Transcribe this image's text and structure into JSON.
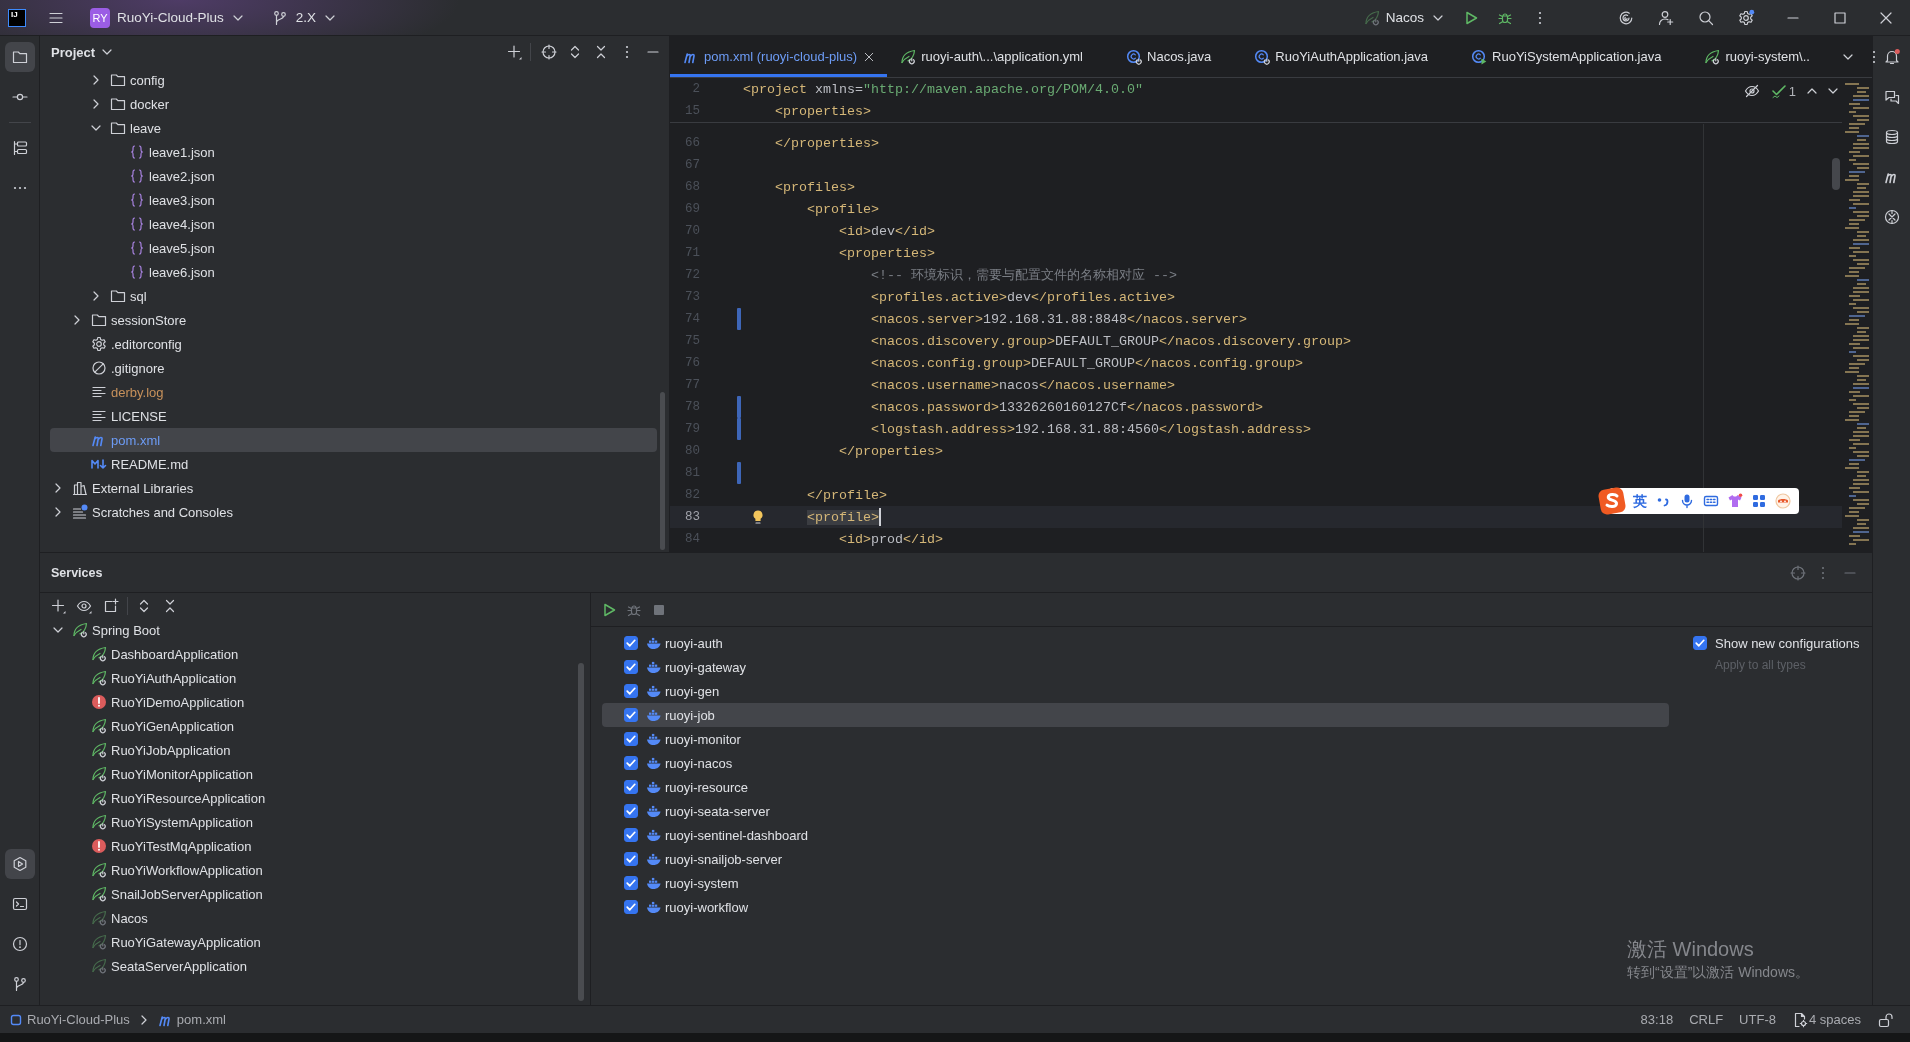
{
  "title_bar": {
    "logo_text": "IJ",
    "project_badge": "RY",
    "project_name": "RuoYi-Cloud-Plus",
    "branch": "2.X",
    "run_configuration": "Nacos",
    "settings_badge": true
  },
  "tool_strip_left": {
    "top": [
      {
        "kind": "project",
        "selected": true
      },
      {
        "kind": "commit",
        "selected": false
      },
      {
        "kind": "structure",
        "selected": false
      },
      {
        "kind": "more",
        "selected": false
      }
    ],
    "bottom": [
      {
        "kind": "services",
        "selected": true
      },
      {
        "kind": "terminal",
        "selected": false
      },
      {
        "kind": "problems",
        "selected": false
      },
      {
        "kind": "git",
        "selected": false
      }
    ]
  },
  "tool_strip_right": [
    {
      "kind": "notifications",
      "badge": true
    },
    {
      "kind": "ai_chat",
      "badge": false
    },
    {
      "kind": "database",
      "badge": false
    },
    {
      "kind": "maven",
      "badge": false
    },
    {
      "kind": "plugin",
      "badge": false
    }
  ],
  "project_panel": {
    "title": "Project",
    "tree": [
      {
        "children": [
          {
            "children": [
              {
                "label": "config",
                "kind": "folder",
                "expanded": false,
                "selected": false,
                "modified": false,
                "ignored": false
              },
              {
                "label": "docker",
                "kind": "folder",
                "expanded": false,
                "selected": false,
                "modified": false,
                "ignored": false
              },
              {
                "label": "leave",
                "kind": "folder",
                "expanded": true,
                "selected": false,
                "modified": false,
                "ignored": false,
                "children": [
                  {
                    "label": "leave1.json",
                    "kind": "json",
                    "selected": false,
                    "modified": false,
                    "ignored": false
                  },
                  {
                    "label": "leave2.json",
                    "kind": "json",
                    "selected": false,
                    "modified": false,
                    "ignored": false
                  },
                  {
                    "label": "leave3.json",
                    "kind": "json",
                    "selected": false,
                    "modified": false,
                    "ignored": false
                  },
                  {
                    "label": "leave4.json",
                    "kind": "json",
                    "selected": false,
                    "modified": false,
                    "ignored": false
                  },
                  {
                    "label": "leave5.json",
                    "kind": "json",
                    "selected": false,
                    "modified": false,
                    "ignored": false
                  },
                  {
                    "label": "leave6.json",
                    "kind": "json",
                    "selected": false,
                    "modified": false,
                    "ignored": false
                  }
                ]
              },
              {
                "label": "sql",
                "kind": "folder",
                "expanded": false,
                "selected": false,
                "modified": false,
                "ignored": false
              }
            ]
          },
          {
            "label": "sessionStore",
            "kind": "folder",
            "expanded": false,
            "selected": false,
            "modified": false,
            "ignored": false
          },
          {
            "label": ".editorconfig",
            "kind": "settings",
            "selected": false,
            "modified": false,
            "ignored": false
          },
          {
            "label": ".gitignore",
            "kind": "ignore",
            "selected": false,
            "modified": false,
            "ignored": false
          },
          {
            "label": "derby.log",
            "kind": "text",
            "selected": false,
            "modified": false,
            "ignored": true
          },
          {
            "label": "LICENSE",
            "kind": "text",
            "selected": false,
            "modified": false,
            "ignored": false
          },
          {
            "label": "pom.xml",
            "kind": "maven",
            "selected": true,
            "modified": true,
            "ignored": false
          },
          {
            "label": "README.md",
            "kind": "markdown",
            "selected": false,
            "modified": false,
            "ignored": false
          }
        ]
      },
      {
        "label": "External Libraries",
        "kind": "library",
        "expanded": false,
        "selected": false,
        "modified": false,
        "ignored": false
      },
      {
        "label": "Scratches and Consoles",
        "kind": "scratches",
        "expanded": false,
        "selected": false,
        "modified": false,
        "ignored": false
      }
    ]
  },
  "editor": {
    "tabs": [
      {
        "label": "pom.xml (ruoyi-cloud-plus)",
        "kind": "maven",
        "selected": true,
        "modified": true
      },
      {
        "label": "ruoyi-auth\\...\\application.yml",
        "kind": "spring-config",
        "selected": false,
        "modified": false
      },
      {
        "label": "Nacos.java",
        "kind": "spring-class",
        "selected": false,
        "modified": false
      },
      {
        "label": "RuoYiAuthApplication.java",
        "kind": "spring-class",
        "selected": false,
        "modified": false
      },
      {
        "label": "RuoYiSystemApplication.java",
        "kind": "run-class",
        "selected": false,
        "modified": false
      },
      {
        "label": "ruoyi-system\\..",
        "kind": "spring-config",
        "selected": false,
        "modified": false
      }
    ],
    "inspection_count": "1",
    "sticky_lines": [
      {
        "number": "2",
        "segments": [
          {
            "kind": "tag",
            "text": "<project"
          },
          {
            "kind": "attr",
            "text": " xmlns="
          },
          {
            "kind": "string",
            "text": "\"http://maven.apache.org/POM/4.0.0\""
          }
        ]
      },
      {
        "number": "15",
        "segments": [
          {
            "kind": "tag",
            "text": "    <properties>"
          }
        ]
      }
    ],
    "lines": [
      {
        "number": "66",
        "changed": false,
        "current": false,
        "segments": [
          {
            "kind": "tag",
            "text": "    </properties>"
          }
        ]
      },
      {
        "number": "67",
        "changed": false,
        "current": false
      },
      {
        "number": "68",
        "changed": false,
        "current": false,
        "segments": [
          {
            "kind": "tag",
            "text": "    <profiles>"
          }
        ]
      },
      {
        "number": "69",
        "changed": false,
        "current": false,
        "segments": [
          {
            "kind": "tag",
            "text": "        <profile>"
          }
        ]
      },
      {
        "number": "70",
        "changed": false,
        "current": false,
        "segments": [
          {
            "kind": "tag",
            "text": "            <id>"
          },
          {
            "kind": "text",
            "text": "dev"
          },
          {
            "kind": "tag",
            "text": "</id>"
          }
        ]
      },
      {
        "number": "71",
        "changed": false,
        "current": false,
        "segments": [
          {
            "kind": "tag",
            "text": "            <properties>"
          }
        ]
      },
      {
        "number": "72",
        "changed": false,
        "current": false,
        "segments": [
          {
            "kind": "comment",
            "text": "                <!-- 环境标识，需要与配置文件的名称相对应 -->"
          }
        ]
      },
      {
        "number": "73",
        "changed": false,
        "current": false,
        "segments": [
          {
            "kind": "tag",
            "text": "                <profiles.active>"
          },
          {
            "kind": "text",
            "text": "dev"
          },
          {
            "kind": "tag",
            "text": "</profiles.active>"
          }
        ]
      },
      {
        "number": "74",
        "changed": true,
        "current": false,
        "segments": [
          {
            "kind": "tag",
            "text": "                <nacos.server>"
          },
          {
            "kind": "text",
            "text": "192.168.31.88:8848"
          },
          {
            "kind": "tag",
            "text": "</nacos.server>"
          }
        ]
      },
      {
        "number": "75",
        "changed": false,
        "current": false,
        "segments": [
          {
            "kind": "tag",
            "text": "                <nacos.discovery.group>"
          },
          {
            "kind": "text",
            "text": "DEFAULT_GROUP"
          },
          {
            "kind": "tag",
            "text": "</nacos.discovery.group>"
          }
        ]
      },
      {
        "number": "76",
        "changed": false,
        "current": false,
        "segments": [
          {
            "kind": "tag",
            "text": "                <nacos.config.group>"
          },
          {
            "kind": "text",
            "text": "DEFAULT_GROUP"
          },
          {
            "kind": "tag",
            "text": "</nacos.config.group>"
          }
        ]
      },
      {
        "number": "77",
        "changed": false,
        "current": false,
        "segments": [
          {
            "kind": "tag",
            "text": "                <nacos.username>"
          },
          {
            "kind": "text",
            "text": "nacos"
          },
          {
            "kind": "tag",
            "text": "</nacos.username>"
          }
        ]
      },
      {
        "number": "78",
        "changed": true,
        "current": false,
        "segments": [
          {
            "kind": "tag",
            "text": "                <nacos.password>"
          },
          {
            "kind": "text",
            "text": "13326260160127Cf"
          },
          {
            "kind": "tag",
            "text": "</nacos.password>"
          }
        ]
      },
      {
        "number": "79",
        "changed": true,
        "current": false,
        "segments": [
          {
            "kind": "tag",
            "text": "                <logstash.address>"
          },
          {
            "kind": "text",
            "text": "192.168.31.88:4560"
          },
          {
            "kind": "tag",
            "text": "</logstash.address>"
          }
        ]
      },
      {
        "number": "80",
        "changed": false,
        "current": false,
        "segments": [
          {
            "kind": "tag",
            "text": "            </properties>"
          }
        ]
      },
      {
        "number": "81",
        "changed": true,
        "current": false
      },
      {
        "number": "82",
        "changed": false,
        "current": false,
        "segments": [
          {
            "kind": "tag",
            "text": "        </profile>"
          }
        ]
      },
      {
        "number": "83",
        "changed": false,
        "current": true,
        "segments": [
          {
            "kind": "tag_match",
            "text": "        <profile>"
          }
        ]
      },
      {
        "number": "84",
        "changed": false,
        "current": false,
        "segments": [
          {
            "kind": "tag",
            "text": "            <id>"
          },
          {
            "kind": "text",
            "text": "prod"
          },
          {
            "kind": "tag",
            "text": "</id>"
          }
        ]
      }
    ]
  },
  "ime_toolbar": {
    "mode": "英"
  },
  "services": {
    "title": "Services",
    "tree": [
      {
        "label": "Spring Boot",
        "expanded": true,
        "children": [
          {
            "label": "DashboardApplication",
            "kind": "app"
          },
          {
            "label": "RuoYiAuthApplication",
            "kind": "app"
          },
          {
            "label": "RuoYiDemoApplication",
            "kind": "error"
          },
          {
            "label": "RuoYiGenApplication",
            "kind": "app"
          },
          {
            "label": "RuoYiJobApplication",
            "kind": "app"
          },
          {
            "label": "RuoYiMonitorApplication",
            "kind": "app"
          },
          {
            "label": "RuoYiResourceApplication",
            "kind": "app"
          },
          {
            "label": "RuoYiSystemApplication",
            "kind": "app"
          },
          {
            "label": "RuoYiTestMqApplication",
            "kind": "error"
          },
          {
            "label": "RuoYiWorkflowApplication",
            "kind": "app"
          },
          {
            "label": "SnailJobServerApplication",
            "kind": "app"
          },
          {
            "label": "Nacos",
            "kind": "inactive"
          },
          {
            "label": "RuoYiGatewayApplication",
            "kind": "inactive"
          },
          {
            "label": "SeataServerApplication",
            "kind": "inactive"
          }
        ]
      }
    ],
    "run_actions": [
      {
        "kind": "run",
        "disabled": false
      },
      {
        "kind": "debug",
        "disabled": true
      },
      {
        "kind": "stop",
        "disabled": true
      }
    ],
    "configurations": [
      {
        "name": "ruoyi-auth",
        "checked": true,
        "selected": false
      },
      {
        "name": "ruoyi-gateway",
        "checked": true,
        "selected": false
      },
      {
        "name": "ruoyi-gen",
        "checked": true,
        "selected": false
      },
      {
        "name": "ruoyi-job",
        "checked": true,
        "selected": true
      },
      {
        "name": "ruoyi-monitor",
        "checked": true,
        "selected": false
      },
      {
        "name": "ruoyi-nacos",
        "checked": true,
        "selected": false
      },
      {
        "name": "ruoyi-resource",
        "checked": true,
        "selected": false
      },
      {
        "name": "ruoyi-seata-server",
        "checked": true,
        "selected": false
      },
      {
        "name": "ruoyi-sentinel-dashboard",
        "checked": true,
        "selected": false
      },
      {
        "name": "ruoyi-snailjob-server",
        "checked": true,
        "selected": false
      },
      {
        "name": "ruoyi-system",
        "checked": true,
        "selected": false
      },
      {
        "name": "ruoyi-workflow",
        "checked": true,
        "selected": false
      }
    ],
    "show_new_configurations": {
      "label": "Show new configurations",
      "checked": true,
      "hint": "Apply to all types"
    }
  },
  "status_bar": {
    "breadcrumbs": [
      {
        "label": "RuoYi-Cloud-Plus",
        "kind": "module"
      },
      {
        "label": "pom.xml",
        "kind": "maven"
      }
    ],
    "caret_position": "83:18",
    "line_separator": "CRLF",
    "encoding": "UTF-8",
    "indent": "4 spaces",
    "read_only": false
  },
  "activation_notice": {
    "title": "激活 Windows",
    "message": "转到“设置”以激活 Windows。"
  }
}
